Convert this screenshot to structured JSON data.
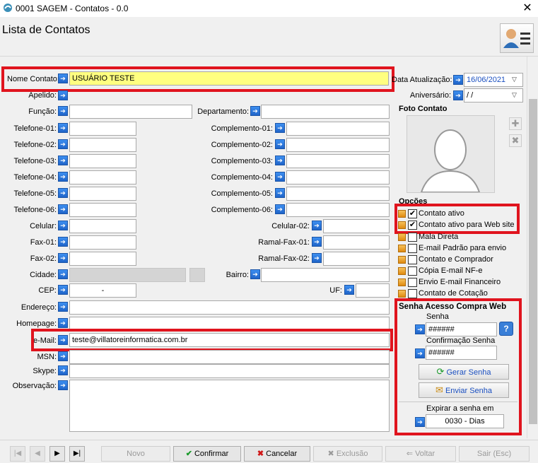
{
  "window": {
    "title": "0001 SAGEM - Contatos - 0.0"
  },
  "header": {
    "title": "Lista de Contatos"
  },
  "form": {
    "nome_label": "Nome Contato:",
    "nome_value": "USUÁRIO TESTE",
    "apelido_label": "Apelido:",
    "funcao_label": "Função:",
    "departamento_label": "Departamento:",
    "telefones": [
      {
        "label": "Telefone-01:"
      },
      {
        "label": "Telefone-02:"
      },
      {
        "label": "Telefone-03:"
      },
      {
        "label": "Telefone-04:"
      },
      {
        "label": "Telefone-05:"
      },
      {
        "label": "Telefone-06:"
      }
    ],
    "complementos": [
      {
        "label": "Complemento-01:"
      },
      {
        "label": "Complemento-02:"
      },
      {
        "label": "Complemento-03:"
      },
      {
        "label": "Complemento-04:"
      },
      {
        "label": "Complemento-05:"
      },
      {
        "label": "Complemento-06:"
      }
    ],
    "celular_label": "Celular:",
    "celular02_label": "Celular-02:",
    "fax01_label": "Fax-01:",
    "ramalfax01_label": "Ramal-Fax-01:",
    "fax02_label": "Fax-02:",
    "ramalfax02_label": "Ramal-Fax-02:",
    "cidade_label": "Cidade:",
    "bairro_label": "Bairro:",
    "cep_label": "CEP:",
    "cep_value": "-",
    "uf_label": "UF:",
    "endereco_label": "Endereço:",
    "homepage_label": "Homepage:",
    "email_label": "e-Mail:",
    "email_value": "teste@villatoreinformatica.com.br",
    "msn_label": "MSN:",
    "skype_label": "Skype:",
    "observacao_label": "Observação:"
  },
  "right": {
    "data_atualizacao_label": "Data Atualização:",
    "data_atualizacao_value": "16/06/2021",
    "aniversario_label": "Aniversário:",
    "aniversario_value": "/ /",
    "foto_label": "Foto Contato",
    "opcoes_label": "Opções",
    "options": [
      {
        "label": "Contato ativo",
        "checked": true
      },
      {
        "label": "Contato ativo para Web site",
        "checked": true
      },
      {
        "label": "Mala Direta",
        "checked": false
      },
      {
        "label": "E-mail  Padrão para envio",
        "checked": false
      },
      {
        "label": "Contato e Comprador",
        "checked": false
      },
      {
        "label": "Cópia E-mail NF-e",
        "checked": false
      },
      {
        "label": "Envio E-mail Financeiro",
        "checked": false
      },
      {
        "label": "Contato de Cotação",
        "checked": false
      }
    ],
    "senha_title": "Senha Acesso Compra Web",
    "senha_label": "Senha",
    "senha_value": "######",
    "confirmacao_label": "Confirmação Senha",
    "confirmacao_value": "######",
    "gerar_label": "Gerar Senha",
    "enviar_label": "Enviar Senha",
    "expirar_label": "Expirar a senha em",
    "expirar_value": "0030 - Dias"
  },
  "bottom": {
    "novo": "Novo",
    "confirmar": "Confirmar",
    "cancelar": "Cancelar",
    "exclusao": "Exclusão",
    "voltar": "Voltar",
    "sair": "Sair (Esc)"
  },
  "colors": {
    "highlight": "#e0141e",
    "nome_bg": "#ffff80"
  }
}
